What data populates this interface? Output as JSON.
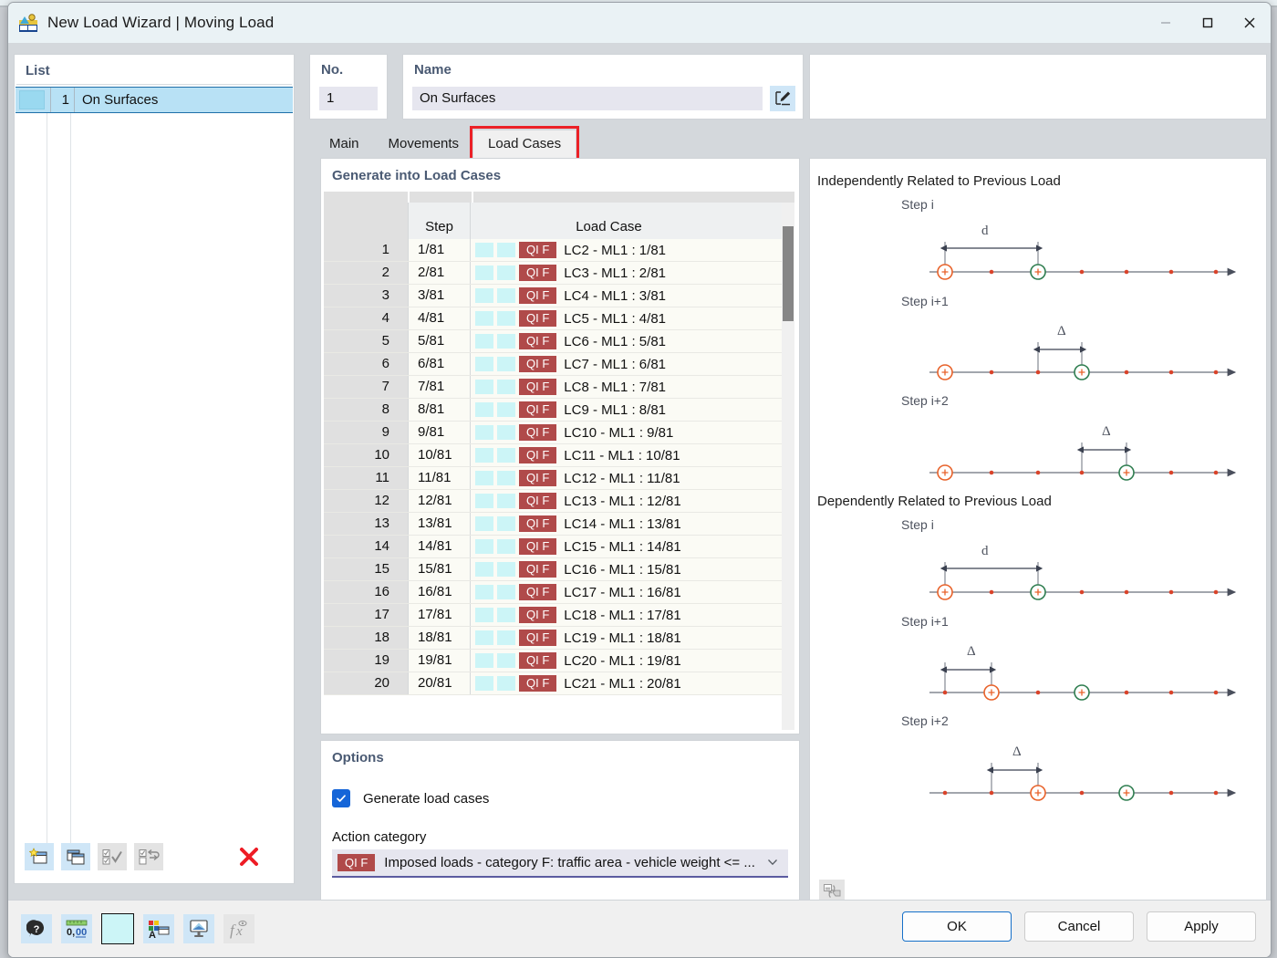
{
  "window": {
    "title": "New Load Wizard | Moving Load",
    "icon": "load-wizard-icon",
    "minimize": "—",
    "maximize": "□",
    "close": "✕"
  },
  "list_panel": {
    "title": "List",
    "rows": [
      {
        "no": "1",
        "name": "On Surfaces"
      }
    ],
    "toolbar": [
      {
        "name": "new-item-button",
        "enabled": true
      },
      {
        "name": "copy-item-button",
        "enabled": true
      },
      {
        "name": "select-all-button",
        "enabled": false
      },
      {
        "name": "invert-selection-button",
        "enabled": false
      },
      {
        "name": "delete-item-button",
        "enabled": true
      }
    ]
  },
  "header": {
    "no_label": "No.",
    "no_value": "1",
    "name_label": "Name",
    "name_value": "On Surfaces",
    "name_placeholder": "Name",
    "edit_button": "edit-name-icon"
  },
  "tabs": [
    {
      "label": "Main",
      "active": false
    },
    {
      "label": "Movements",
      "active": false
    },
    {
      "label": "Load Cases",
      "active": true,
      "highlighted": true
    }
  ],
  "generate_card": {
    "title": "Generate into Load Cases",
    "columns": [
      "",
      "Step",
      "Load Case"
    ],
    "rows": [
      {
        "idx": "1",
        "step": "1/81",
        "badge": "QI F",
        "load_case": "LC2 - ML1 : 1/81"
      },
      {
        "idx": "2",
        "step": "2/81",
        "badge": "QI F",
        "load_case": "LC3 - ML1 : 2/81"
      },
      {
        "idx": "3",
        "step": "3/81",
        "badge": "QI F",
        "load_case": "LC4 - ML1 : 3/81"
      },
      {
        "idx": "4",
        "step": "4/81",
        "badge": "QI F",
        "load_case": "LC5 - ML1 : 4/81"
      },
      {
        "idx": "5",
        "step": "5/81",
        "badge": "QI F",
        "load_case": "LC6 - ML1 : 5/81"
      },
      {
        "idx": "6",
        "step": "6/81",
        "badge": "QI F",
        "load_case": "LC7 - ML1 : 6/81"
      },
      {
        "idx": "7",
        "step": "7/81",
        "badge": "QI F",
        "load_case": "LC8 - ML1 : 7/81"
      },
      {
        "idx": "8",
        "step": "8/81",
        "badge": "QI F",
        "load_case": "LC9 - ML1 : 8/81"
      },
      {
        "idx": "9",
        "step": "9/81",
        "badge": "QI F",
        "load_case": "LC10 - ML1 : 9/81"
      },
      {
        "idx": "10",
        "step": "10/81",
        "badge": "QI F",
        "load_case": "LC11 - ML1 : 10/81"
      },
      {
        "idx": "11",
        "step": "11/81",
        "badge": "QI F",
        "load_case": "LC12 - ML1 : 11/81"
      },
      {
        "idx": "12",
        "step": "12/81",
        "badge": "QI F",
        "load_case": "LC13 - ML1 : 12/81"
      },
      {
        "idx": "13",
        "step": "13/81",
        "badge": "QI F",
        "load_case": "LC14 - ML1 : 13/81"
      },
      {
        "idx": "14",
        "step": "14/81",
        "badge": "QI F",
        "load_case": "LC15 - ML1 : 14/81"
      },
      {
        "idx": "15",
        "step": "15/81",
        "badge": "QI F",
        "load_case": "LC16 - ML1 : 15/81"
      },
      {
        "idx": "16",
        "step": "16/81",
        "badge": "QI F",
        "load_case": "LC17 - ML1 : 16/81"
      },
      {
        "idx": "17",
        "step": "17/81",
        "badge": "QI F",
        "load_case": "LC18 - ML1 : 17/81"
      },
      {
        "idx": "18",
        "step": "18/81",
        "badge": "QI F",
        "load_case": "LC19 - ML1 : 18/81"
      },
      {
        "idx": "19",
        "step": "19/81",
        "badge": "QI F",
        "load_case": "LC20 - ML1 : 19/81"
      },
      {
        "idx": "20",
        "step": "20/81",
        "badge": "QI F",
        "load_case": "LC21 - ML1 : 20/81"
      }
    ]
  },
  "options": {
    "title": "Options",
    "generate_load_cases": {
      "label": "Generate load cases",
      "checked": true
    },
    "action_category": {
      "label": "Action category",
      "badge": "QI F",
      "value": "Imposed loads - category F: traffic area - vehicle weight <= ...",
      "arrow": "chevron-down-icon"
    }
  },
  "diagrams": {
    "independent": {
      "title": "Independently Related to Previous Load",
      "steps": [
        {
          "label": "Step i",
          "dim": "d"
        },
        {
          "label": "Step i+1",
          "dim": "Δ"
        },
        {
          "label": "Step i+2",
          "dim": "Δ"
        }
      ]
    },
    "dependent": {
      "title": "Dependently Related to Previous Load",
      "steps": [
        {
          "label": "Step i",
          "dim": "d"
        },
        {
          "label": "Step i+1",
          "dim": "Δ"
        },
        {
          "label": "Step i+2",
          "dim": "Δ"
        }
      ]
    },
    "swap_icon": "image-swap-icon"
  },
  "footer": {
    "tools": [
      {
        "name": "help-button",
        "enabled": true
      },
      {
        "name": "units-decimal-button",
        "enabled": true
      },
      {
        "name": "color-swatch-button",
        "enabled": true
      },
      {
        "name": "display-properties-button",
        "enabled": true
      },
      {
        "name": "visibility-button",
        "enabled": true
      },
      {
        "name": "formula-button",
        "enabled": false
      }
    ],
    "buttons": [
      {
        "label": "OK",
        "primary": true
      },
      {
        "label": "Cancel",
        "primary": false
      },
      {
        "label": "Apply",
        "primary": false
      }
    ]
  },
  "colors": {
    "badge_red": "#b04a4a",
    "accent_blue": "#1565d8",
    "highlight_red": "#ec2127",
    "selection_blue": "#b8e1f5",
    "swatch_cyan": "#ccf5f7",
    "panel_title": "#4a5a73",
    "diagram_orange": "#e8622a",
    "diagram_green": "#2e7d4f",
    "diagram_axis": "#5a5f6e"
  }
}
